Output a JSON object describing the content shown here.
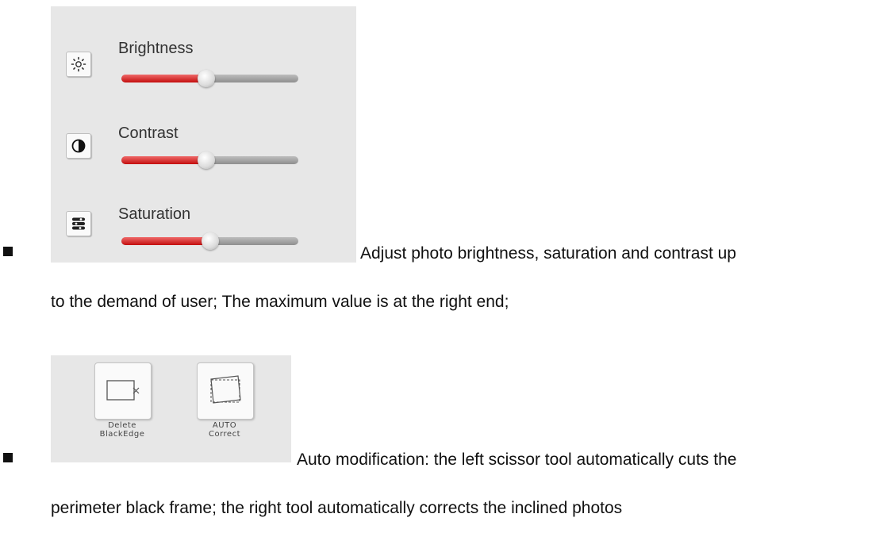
{
  "adjustments": [
    {
      "label": "Brightness",
      "icon": "brightness-icon",
      "value": 0.48
    },
    {
      "label": "Contrast",
      "icon": "contrast-icon",
      "value": 0.48
    },
    {
      "label": "Saturation",
      "icon": "saturation-icon",
      "value": 0.5
    }
  ],
  "colors": {
    "track_fill": "#d0191b",
    "track_empty": "#9e9e9e",
    "panel_bg": "#e7e7e7"
  },
  "para1": {
    "line1": "Adjust photo brightness, saturation and contrast up",
    "line2": "to the demand of user; The maximum value is at the right end;"
  },
  "tools": [
    {
      "line1": "Delete",
      "line2": "BlackEdge",
      "icon": "delete-black-edge-icon"
    },
    {
      "line1": "AUTO",
      "line2": "Correct",
      "icon": "auto-correct-icon"
    }
  ],
  "para2": {
    "line1": "Auto modification: the left scissor tool automatically cuts the",
    "line2": "perimeter black frame; the right tool automatically corrects the inclined photos"
  }
}
